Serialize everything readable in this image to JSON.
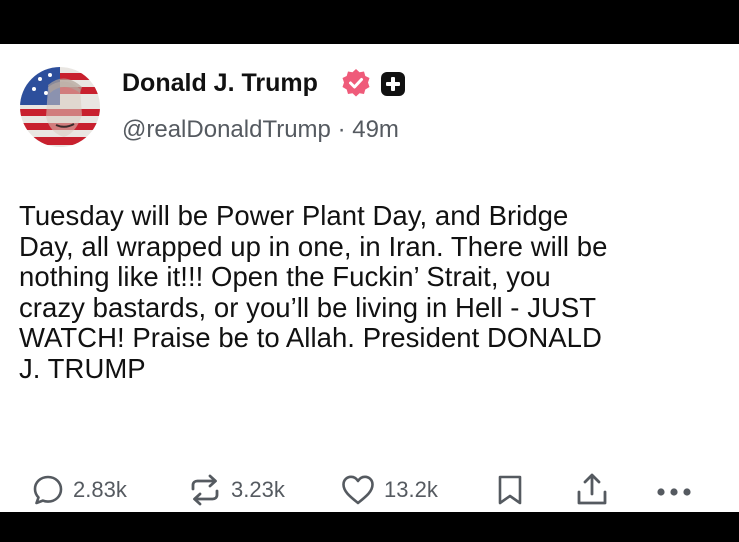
{
  "post": {
    "author_name": "Donald J. Trump",
    "handle": "@realDonaldTrump",
    "separator": "·",
    "time_ago": "49m",
    "text": "Tuesday will be Power Plant Day, and Bridge\nDay, all wrapped up in one, in Iran. There will be\nnothing like it!!! Open the Fuckin’ Strait, you\ncrazy bastards, or you’ll be living in Hell - JUST\nWATCH! Praise be to Allah. President DONALD\nJ. TRUMP"
  },
  "actions": {
    "replies": "2.83k",
    "reposts": "3.23k",
    "likes": "13.2k"
  },
  "icons": {
    "verified": "verified-badge-icon",
    "plus": "plus-badge-icon",
    "reply": "reply-icon",
    "repost": "repost-icon",
    "like": "heart-icon",
    "bookmark": "bookmark-icon",
    "share": "share-icon",
    "more": "more-icon"
  },
  "colors": {
    "verified": "#ef5b7a",
    "text": "#111111",
    "muted": "#555a60"
  }
}
